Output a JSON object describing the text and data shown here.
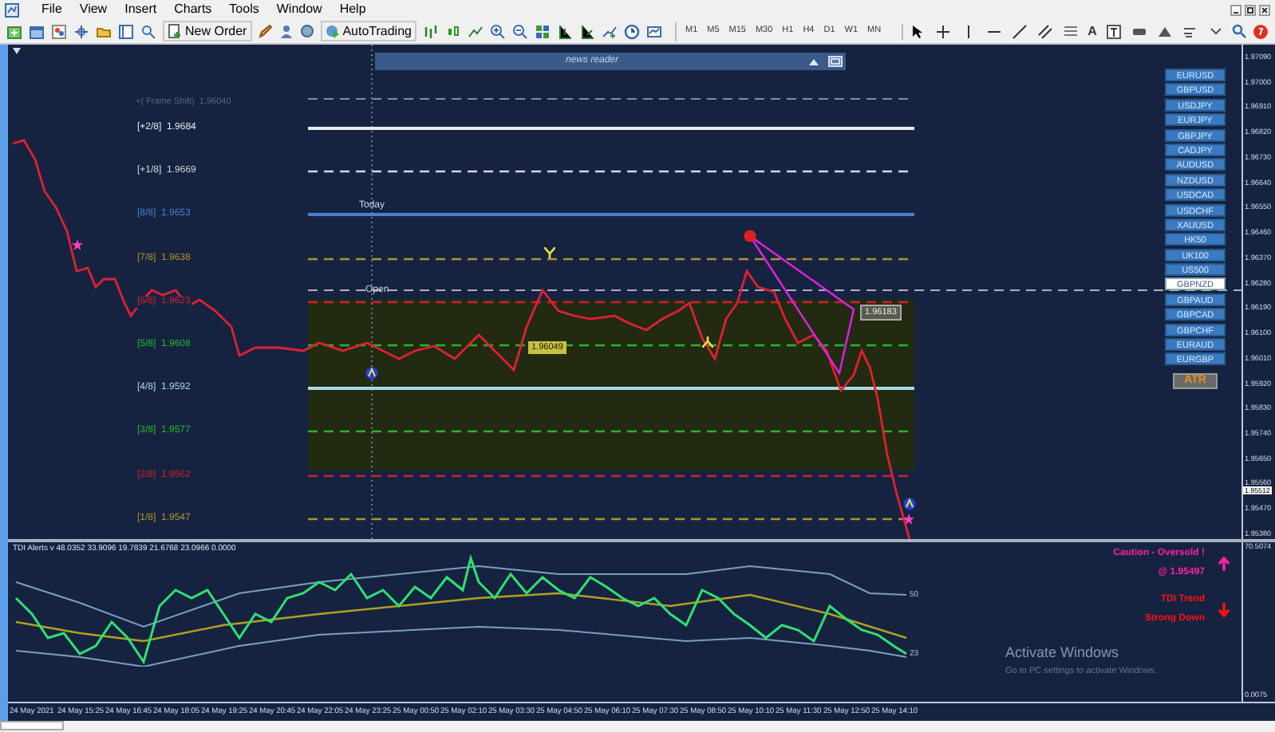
{
  "menu": [
    "File",
    "View",
    "Insert",
    "Charts",
    "Tools",
    "Window",
    "Help"
  ],
  "toolbar": {
    "buttons": [
      {
        "label": "New Order",
        "kind": "order"
      },
      {
        "label": "AutoTrading",
        "kind": "auto"
      }
    ],
    "timeframes": [
      "M1",
      "M5",
      "M15",
      "M30",
      "H1",
      "H4",
      "D1",
      "W1",
      "MN"
    ],
    "text_tool": "A"
  },
  "chart": {
    "news_reader": {
      "title": "news reader"
    },
    "frame_shift": "+( Frame Shift)  1.96040",
    "levels": [
      {
        "tag": "[+2/8]",
        "price": "1.9684",
        "color": "#e8e8e8",
        "kind": "solid"
      },
      {
        "tag": "[+1/8]",
        "price": "1.9669",
        "color": "#d8d8d8",
        "kind": "dashed"
      },
      {
        "tag": "[8/8]",
        "price": "1.9653",
        "color": "#4a7fd6",
        "kind": "solid"
      },
      {
        "tag": "[7/8]",
        "price": "1.9638",
        "color": "#b8902a",
        "kind": "dashed"
      },
      {
        "tag": "[6/8]",
        "price": "1.9623",
        "color": "#d0202a",
        "kind": "dashed"
      },
      {
        "tag": "[5/8]",
        "price": "1.9608",
        "color": "#22b82a",
        "kind": "dashed"
      },
      {
        "tag": "[4/8]",
        "price": "1.9592",
        "color": "#a9d8e0",
        "kind": "solid"
      },
      {
        "tag": "[3/8]",
        "price": "1.9577",
        "color": "#22b82a",
        "kind": "dashed"
      },
      {
        "tag": "[2/8]",
        "price": "1.9562",
        "color": "#d0202a",
        "kind": "dashed"
      },
      {
        "tag": "[1/8]",
        "price": "1.9547",
        "color": "#b8902a",
        "kind": "dashed"
      }
    ],
    "today_label": "Today",
    "open_label": "Open",
    "price_tags": [
      {
        "text": "1.96049",
        "kind": "support"
      },
      {
        "text": "1.96183",
        "kind": "resistance"
      }
    ],
    "symbols": [
      {
        "label": "EURUSD",
        "selected": false
      },
      {
        "label": "GBPUSD",
        "selected": false
      },
      {
        "label": "USDJPY",
        "selected": false
      },
      {
        "label": "EURJPY",
        "selected": false
      },
      {
        "label": "GBPJPY",
        "selected": false
      },
      {
        "label": "CADJPY",
        "selected": false
      },
      {
        "label": "AUDUSD",
        "selected": false
      },
      {
        "label": "NZDUSD",
        "selected": false
      },
      {
        "label": "USDCAD",
        "selected": false
      },
      {
        "label": "USDCHF",
        "selected": false
      },
      {
        "label": "XAUUSD",
        "selected": false
      },
      {
        "label": "HK50",
        "selected": false
      },
      {
        "label": "UK100",
        "selected": false
      },
      {
        "label": "US500",
        "selected": false
      },
      {
        "label": "GBPNZD",
        "selected": true
      },
      {
        "label": "GBPAUD",
        "selected": false
      },
      {
        "label": "GBPCAD",
        "selected": false
      },
      {
        "label": "GBPCHF",
        "selected": false
      },
      {
        "label": "EURAUD",
        "selected": false
      },
      {
        "label": "EURGBP",
        "selected": false
      }
    ],
    "atr_button": "ATR",
    "price_axis": [
      "1.97090",
      "1.97000",
      "1.96910",
      "1.96820",
      "1.96730",
      "1.96640",
      "1.96550",
      "1.96460",
      "1.96370",
      "1.96280",
      "1.96190",
      "1.96100",
      "1.96010",
      "1.95920",
      "1.95830",
      "1.95740",
      "1.95650",
      "1.95560",
      "1.95470",
      "1.95380"
    ],
    "current_price": "1.95512"
  },
  "indicator": {
    "title": "TDI Alerts v 48.0352 33.9096 19.7839 21.6768 23.0966 0.0000",
    "band_labels": [
      "50",
      "23"
    ],
    "alerts": [
      {
        "kind": "up",
        "color": "#ff1fa0",
        "lines": [
          "Caution - Oversold !",
          "@ 1.95497"
        ]
      },
      {
        "kind": "down",
        "color": "#ff1010",
        "lines": [
          "TDI Trend",
          "Strong Down"
        ]
      }
    ],
    "axis": [
      "70.5074",
      "0.0075"
    ]
  },
  "time_axis": [
    "24 May 2021",
    "24 May 15:25",
    "24 May 16:45",
    "24 May 18:05",
    "24 May 19:25",
    "24 May 20:45",
    "24 May 22:05",
    "24 May 23:25",
    "25 May 00:50",
    "25 May 02:10",
    "25 May 03:30",
    "25 May 04:50",
    "25 May 06:10",
    "25 May 07:30",
    "25 May 08:50",
    "25 May 10:10",
    "25 May 11:30",
    "25 May 12:50",
    "25 May 14:10"
  ],
  "os_notice": {
    "title": "Activate Windows",
    "detail": "Go to PC settings to activate Windows."
  }
}
